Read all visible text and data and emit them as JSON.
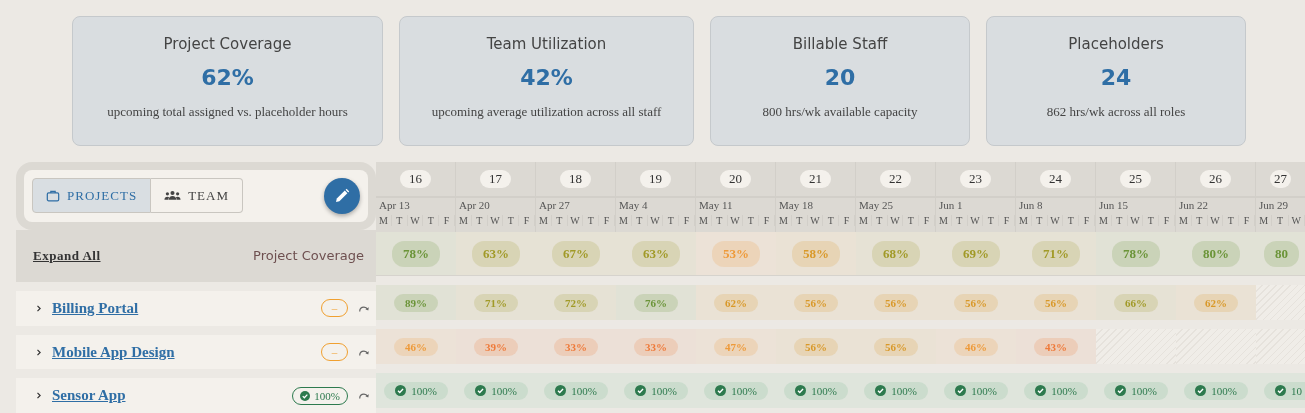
{
  "stats": [
    {
      "title": "Project Coverage",
      "value": "62%",
      "caption": "upcoming total assigned vs. placeholder hours"
    },
    {
      "title": "Team Utilization",
      "value": "42%",
      "caption": "upcoming average utilization across all staff"
    },
    {
      "title": "Billable Staff",
      "value": "20",
      "caption": "800 hrs/wk available capacity"
    },
    {
      "title": "Placeholders",
      "value": "24",
      "caption": "862 hrs/wk across all roles"
    }
  ],
  "view_tabs": [
    {
      "label": "PROJECTS",
      "selected": true
    },
    {
      "label": "TEAM",
      "selected": false
    }
  ],
  "expand_all": "Expand All",
  "coverage_label": "Project Coverage",
  "weeks": [
    {
      "number": "16",
      "date": "Apr 13",
      "days": [
        "M",
        "T",
        "W",
        "T",
        "F"
      ]
    },
    {
      "number": "17",
      "date": "Apr 20",
      "days": [
        "M",
        "T",
        "W",
        "T",
        "F"
      ]
    },
    {
      "number": "18",
      "date": "Apr 27",
      "days": [
        "M",
        "T",
        "W",
        "T",
        "F"
      ]
    },
    {
      "number": "19",
      "date": "May 4",
      "days": [
        "M",
        "T",
        "W",
        "T",
        "F"
      ]
    },
    {
      "number": "20",
      "date": "May 11",
      "days": [
        "M",
        "T",
        "W",
        "T",
        "F"
      ]
    },
    {
      "number": "21",
      "date": "May 18",
      "days": [
        "M",
        "T",
        "W",
        "T",
        "F"
      ]
    },
    {
      "number": "22",
      "date": "May 25",
      "days": [
        "M",
        "T",
        "W",
        "T",
        "F"
      ]
    },
    {
      "number": "23",
      "date": "Jun 1",
      "days": [
        "M",
        "T",
        "W",
        "T",
        "F"
      ]
    },
    {
      "number": "24",
      "date": "Jun 8",
      "days": [
        "M",
        "T",
        "W",
        "T",
        "F"
      ]
    },
    {
      "number": "25",
      "date": "Jun 15",
      "days": [
        "M",
        "T",
        "W",
        "T",
        "F"
      ]
    },
    {
      "number": "26",
      "date": "Jun 22",
      "days": [
        "M",
        "T",
        "W",
        "T",
        "F"
      ]
    },
    {
      "number": "27",
      "date": "Jun 29",
      "days": [
        "M",
        "T",
        "W"
      ]
    }
  ],
  "coverage": [
    {
      "kind": "percent",
      "value": "78%",
      "color": "#6b9438"
    },
    {
      "kind": "percent",
      "value": "63%",
      "color": "#a19a28"
    },
    {
      "kind": "percent",
      "value": "67%",
      "color": "#a19a28"
    },
    {
      "kind": "percent",
      "value": "63%",
      "color": "#a19a28"
    },
    {
      "kind": "percent",
      "value": "53%",
      "color": "#ee9a3a"
    },
    {
      "kind": "percent",
      "value": "58%",
      "color": "#d9992a"
    },
    {
      "kind": "percent",
      "value": "68%",
      "color": "#a19a28"
    },
    {
      "kind": "percent",
      "value": "69%",
      "color": "#a19a28"
    },
    {
      "kind": "percent",
      "value": "71%",
      "color": "#a19a28"
    },
    {
      "kind": "percent",
      "value": "78%",
      "color": "#6b9438"
    },
    {
      "kind": "percent",
      "value": "80%",
      "color": "#6b9438"
    },
    {
      "kind": "percent",
      "value": "80",
      "color": "#6b9438"
    }
  ],
  "projects": [
    {
      "name": "Billing Portal",
      "status": {
        "kind": "warning",
        "text": "–"
      },
      "cells": [
        {
          "kind": "percent",
          "value": "89%",
          "color": "#6b9438"
        },
        {
          "kind": "percent",
          "value": "71%",
          "color": "#a19a28"
        },
        {
          "kind": "percent",
          "value": "72%",
          "color": "#a19a28"
        },
        {
          "kind": "percent",
          "value": "76%",
          "color": "#6b9438"
        },
        {
          "kind": "percent",
          "value": "62%",
          "color": "#d9992a"
        },
        {
          "kind": "percent",
          "value": "56%",
          "color": "#d9992a"
        },
        {
          "kind": "percent",
          "value": "56%",
          "color": "#d9992a"
        },
        {
          "kind": "percent",
          "value": "56%",
          "color": "#d9992a"
        },
        {
          "kind": "percent",
          "value": "56%",
          "color": "#d9992a"
        },
        {
          "kind": "percent",
          "value": "66%",
          "color": "#a19a28"
        },
        {
          "kind": "percent",
          "value": "62%",
          "color": "#d9992a"
        },
        {
          "kind": "empty"
        }
      ]
    },
    {
      "name": "Mobile App Design",
      "status": {
        "kind": "warning",
        "text": "–"
      },
      "cells": [
        {
          "kind": "percent",
          "value": "46%",
          "color": "#ee9a3a"
        },
        {
          "kind": "percent",
          "value": "39%",
          "color": "#ef7a3a"
        },
        {
          "kind": "percent",
          "value": "33%",
          "color": "#ef7a3a"
        },
        {
          "kind": "percent",
          "value": "33%",
          "color": "#ef7a3a"
        },
        {
          "kind": "percent",
          "value": "47%",
          "color": "#ee9a3a"
        },
        {
          "kind": "percent",
          "value": "56%",
          "color": "#d9992a"
        },
        {
          "kind": "percent",
          "value": "56%",
          "color": "#d9992a"
        },
        {
          "kind": "percent",
          "value": "46%",
          "color": "#ee9a3a"
        },
        {
          "kind": "percent",
          "value": "43%",
          "color": "#ef7a3a"
        },
        {
          "kind": "empty"
        },
        {
          "kind": "empty"
        },
        {
          "kind": "empty"
        }
      ]
    },
    {
      "name": "Sensor App",
      "status": {
        "kind": "complete",
        "text": "100%"
      },
      "cells": [
        {
          "kind": "complete",
          "value": "100%"
        },
        {
          "kind": "complete",
          "value": "100%"
        },
        {
          "kind": "complete",
          "value": "100%"
        },
        {
          "kind": "complete",
          "value": "100%"
        },
        {
          "kind": "complete",
          "value": "100%"
        },
        {
          "kind": "complete",
          "value": "100%"
        },
        {
          "kind": "complete",
          "value": "100%"
        },
        {
          "kind": "complete",
          "value": "100%"
        },
        {
          "kind": "complete",
          "value": "100%"
        },
        {
          "kind": "complete",
          "value": "100%"
        },
        {
          "kind": "complete",
          "value": "100%"
        },
        {
          "kind": "complete",
          "value": "10"
        }
      ]
    }
  ]
}
